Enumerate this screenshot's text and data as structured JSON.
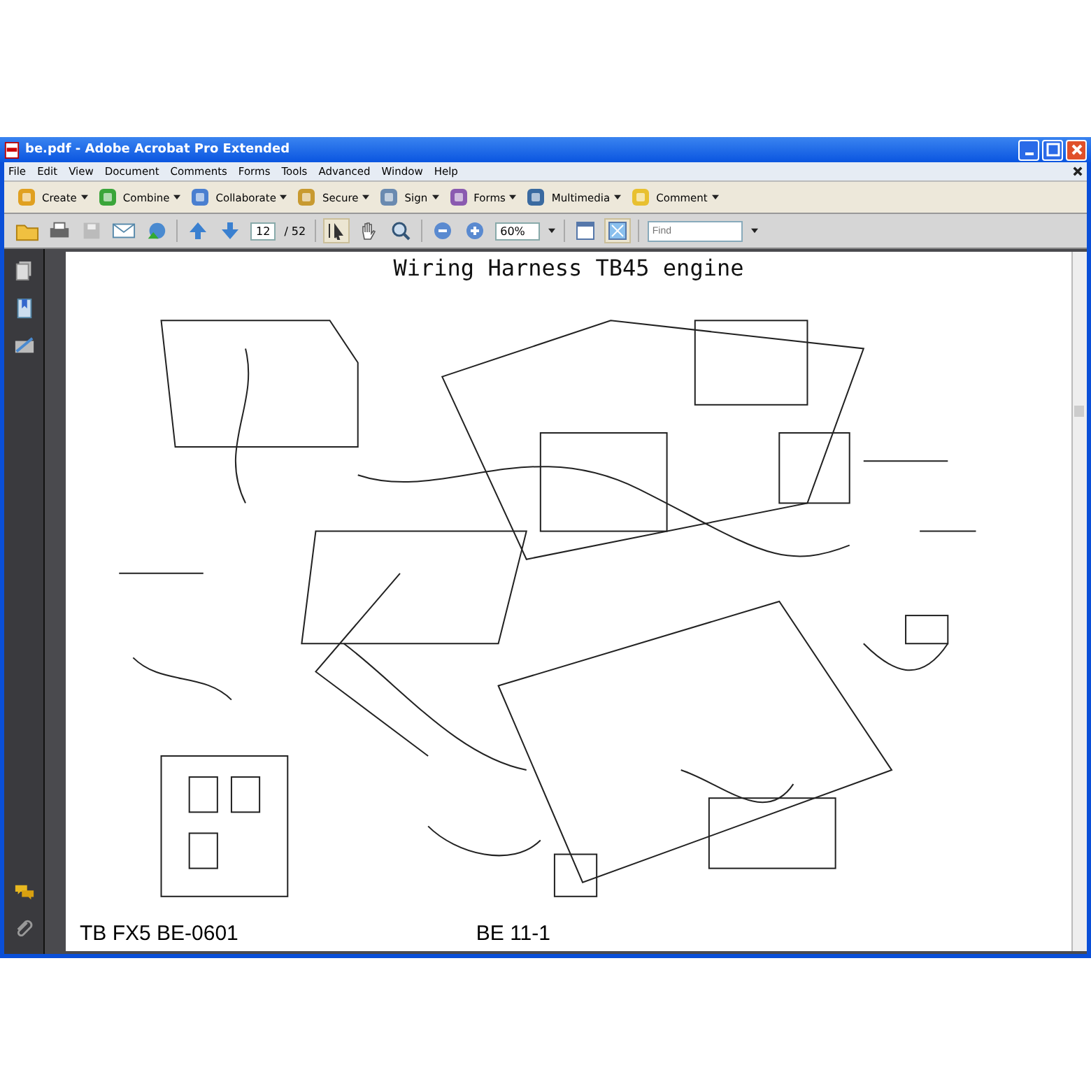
{
  "window": {
    "title": "be.pdf - Adobe Acrobat Pro Extended"
  },
  "menu": [
    "File",
    "Edit",
    "View",
    "Document",
    "Comments",
    "Forms",
    "Tools",
    "Advanced",
    "Window",
    "Help"
  ],
  "task_buttons": [
    {
      "label": "Create"
    },
    {
      "label": "Combine"
    },
    {
      "label": "Collaborate"
    },
    {
      "label": "Secure"
    },
    {
      "label": "Sign"
    },
    {
      "label": "Forms"
    },
    {
      "label": "Multimedia"
    },
    {
      "label": "Comment"
    }
  ],
  "page_nav": {
    "current": "12",
    "total": "/ 52"
  },
  "zoom": {
    "value": "60%"
  },
  "find": {
    "placeholder": "Find"
  },
  "document": {
    "title": "Wiring Harness TB45 engine",
    "footer_left": "TB FX5 BE-0601",
    "footer_center": "BE 11-1"
  }
}
